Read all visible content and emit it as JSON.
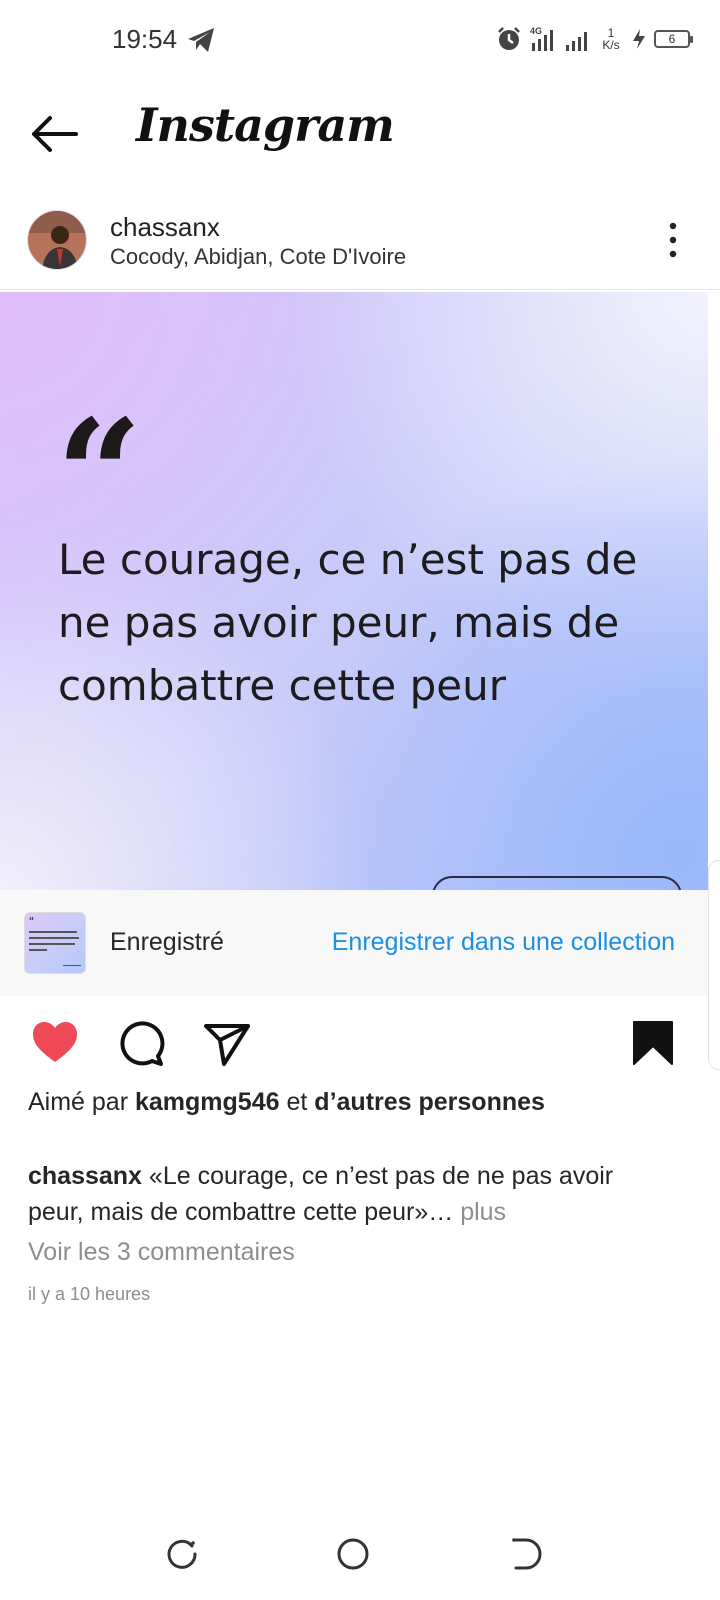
{
  "status_bar": {
    "time": "19:54",
    "network": "4G",
    "speed_value": "1",
    "speed_unit": "K/s",
    "battery": "6"
  },
  "header": {
    "brand": "Instagram"
  },
  "post": {
    "username": "chassanx",
    "location": "Cocody, Abidjan, Cote D'Ivoire",
    "image": {
      "quote_mark": "“",
      "quote_text": "Le courage, ce n’est pas de ne pas avoir peur, mais de combattre cette peur"
    }
  },
  "save_bar": {
    "label": "Enregistré",
    "collection_link": "Enregistrer dans une collection"
  },
  "likes": {
    "prefix": "Aimé par",
    "user": "kamgmg546",
    "middle": "et",
    "others": "d’autres personnes"
  },
  "caption": {
    "user": "chassanx",
    "text": "«Le courage, ce n’est pas de ne pas avoir peur, mais de combattre cette peur»…",
    "more": "plus"
  },
  "comments": {
    "view_label": "Voir les 3 commentaires"
  },
  "timestamp": "il y a 10 heures",
  "colors": {
    "like_red": "#ed4956",
    "link_blue": "#1a8fe3",
    "secondary_text": "#8e8e8e"
  },
  "icons": {
    "back": "arrow-left-icon",
    "more": "more-vertical-icon",
    "like": "heart-filled-icon",
    "comment": "comment-icon",
    "share": "send-icon",
    "save": "bookmark-filled-icon"
  }
}
